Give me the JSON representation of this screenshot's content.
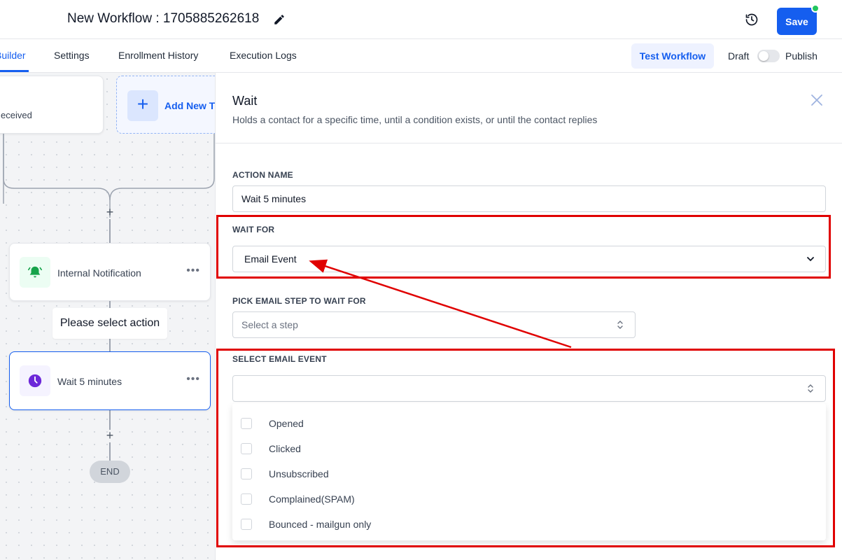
{
  "header": {
    "title": "New Workflow : 1705885262618",
    "save_label": "Save"
  },
  "tabs": [
    {
      "label": "Builder",
      "active": true
    },
    {
      "label": "Settings"
    },
    {
      "label": "Enrollment History"
    },
    {
      "label": "Execution Logs"
    }
  ],
  "toolbar": {
    "test_label": "Test Workflow",
    "draft_label": "Draft",
    "publish_label": "Publish"
  },
  "canvas": {
    "trigger_text": "eceived",
    "add_trigger_label": "Add New Trigger",
    "nodes": [
      {
        "label": "Internal Notification",
        "icon": "bell-icon"
      },
      {
        "label": "Wait 5 minutes",
        "icon": "clock-icon"
      }
    ],
    "select_action_label": "Please select action",
    "end_label": "END"
  },
  "panel": {
    "title": "Wait",
    "subtitle": "Holds a contact for a specific time, until a condition exists, or until the contact replies",
    "action_name_label": "ACTION NAME",
    "action_name_value": "Wait 5 minutes",
    "wait_for_label": "WAIT FOR",
    "wait_for_value": "Email Event",
    "pick_step_label": "PICK EMAIL STEP TO WAIT FOR",
    "pick_step_placeholder": "Select a step",
    "select_event_label": "SELECT EMAIL EVENT",
    "select_event_value": "",
    "event_options": [
      "Opened",
      "Clicked",
      "Unsubscribed",
      "Complained(SPAM)",
      "Bounced - mailgun only"
    ]
  },
  "colors": {
    "primary": "#155eef",
    "annotation": "#e00000",
    "status_dot": "#22c55e",
    "notification_icon": "#16a34a",
    "wait_icon": "#6d28d9"
  }
}
